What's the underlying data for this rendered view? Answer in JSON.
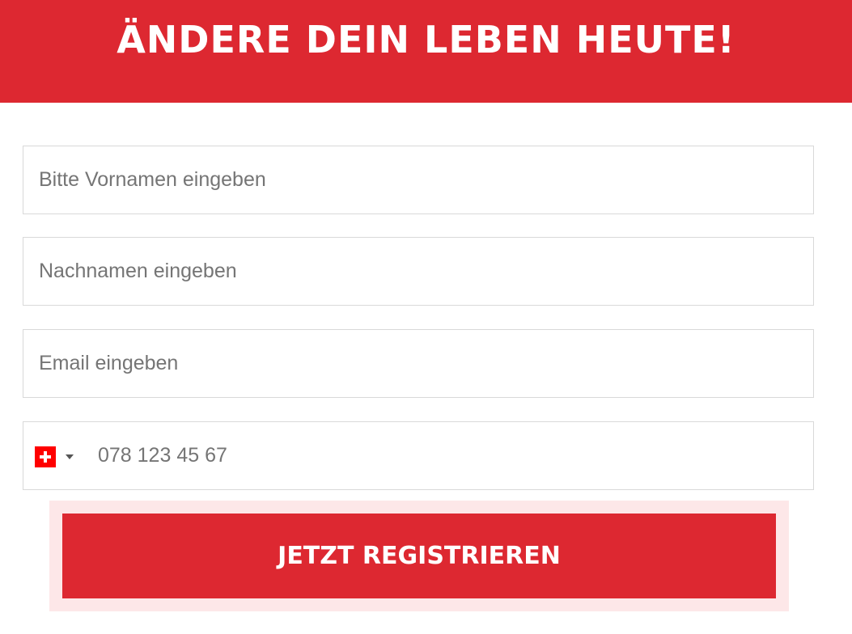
{
  "header": {
    "title": "ÄNDERE DEIN LEBEN HEUTE!"
  },
  "form": {
    "first_name": {
      "value": "",
      "placeholder": "Bitte Vornamen eingeben"
    },
    "last_name": {
      "value": "",
      "placeholder": "Nachnamen eingeben"
    },
    "email": {
      "value": "",
      "placeholder": "Email eingeben"
    },
    "phone": {
      "value": "",
      "placeholder": "078 123 45 67",
      "country_flag_icon": "flag-switzerland-icon",
      "dropdown_icon": "caret-down-icon"
    },
    "submit_label": "JETZT REGISTRIEREN"
  },
  "colors": {
    "accent": "#dd2831",
    "button_halo": "#fde7e8",
    "border": "#d9d9d9",
    "placeholder": "#757575"
  }
}
